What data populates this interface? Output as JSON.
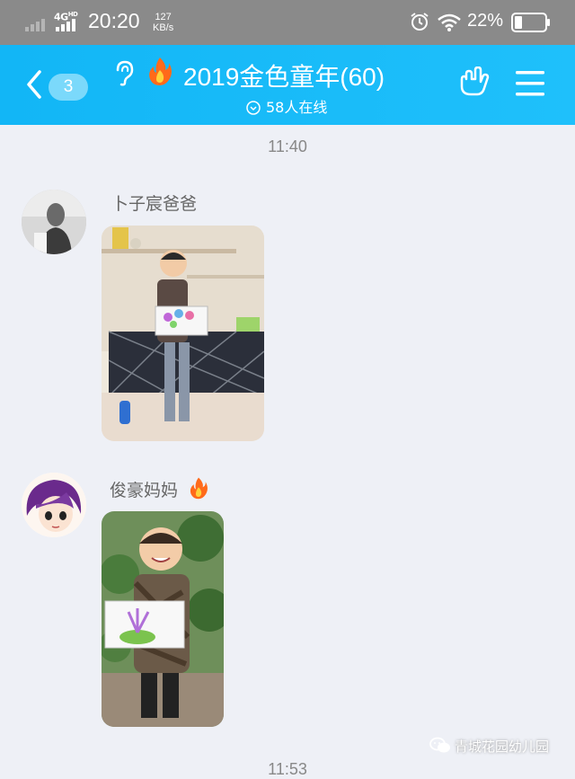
{
  "status_bar": {
    "network": "4G",
    "network_sup": "HD",
    "time": "20:20",
    "speed_value": "127",
    "speed_unit": "KB/s",
    "battery_percent": "22%",
    "icons": [
      "signal-icon",
      "alarm-icon",
      "wifi-icon",
      "battery-icon"
    ]
  },
  "header": {
    "unread_count": "3",
    "group_title": "2019金色童年(60)",
    "online_status": "58人在线",
    "icons": [
      "back-chevron-icon",
      "ear-icon",
      "fire-icon",
      "gesture-icon",
      "menu-icon"
    ],
    "colors": {
      "header_bg": "#12b6f6",
      "badge_bg": "#7bd9fb"
    }
  },
  "chat": {
    "timestamp_1": "11:40",
    "messages": [
      {
        "sender": "卜子宸爸爸",
        "type": "image",
        "image_desc": "child-holding-drawing-photo"
      },
      {
        "sender": "俊豪妈妈",
        "type": "image",
        "image_desc": "child-holding-drawing-photo",
        "badge_icon": "fire-icon"
      }
    ],
    "timestamp_2": "11:53"
  },
  "watermark": {
    "text": "青城花园幼儿园",
    "icon": "wechat-icon"
  }
}
